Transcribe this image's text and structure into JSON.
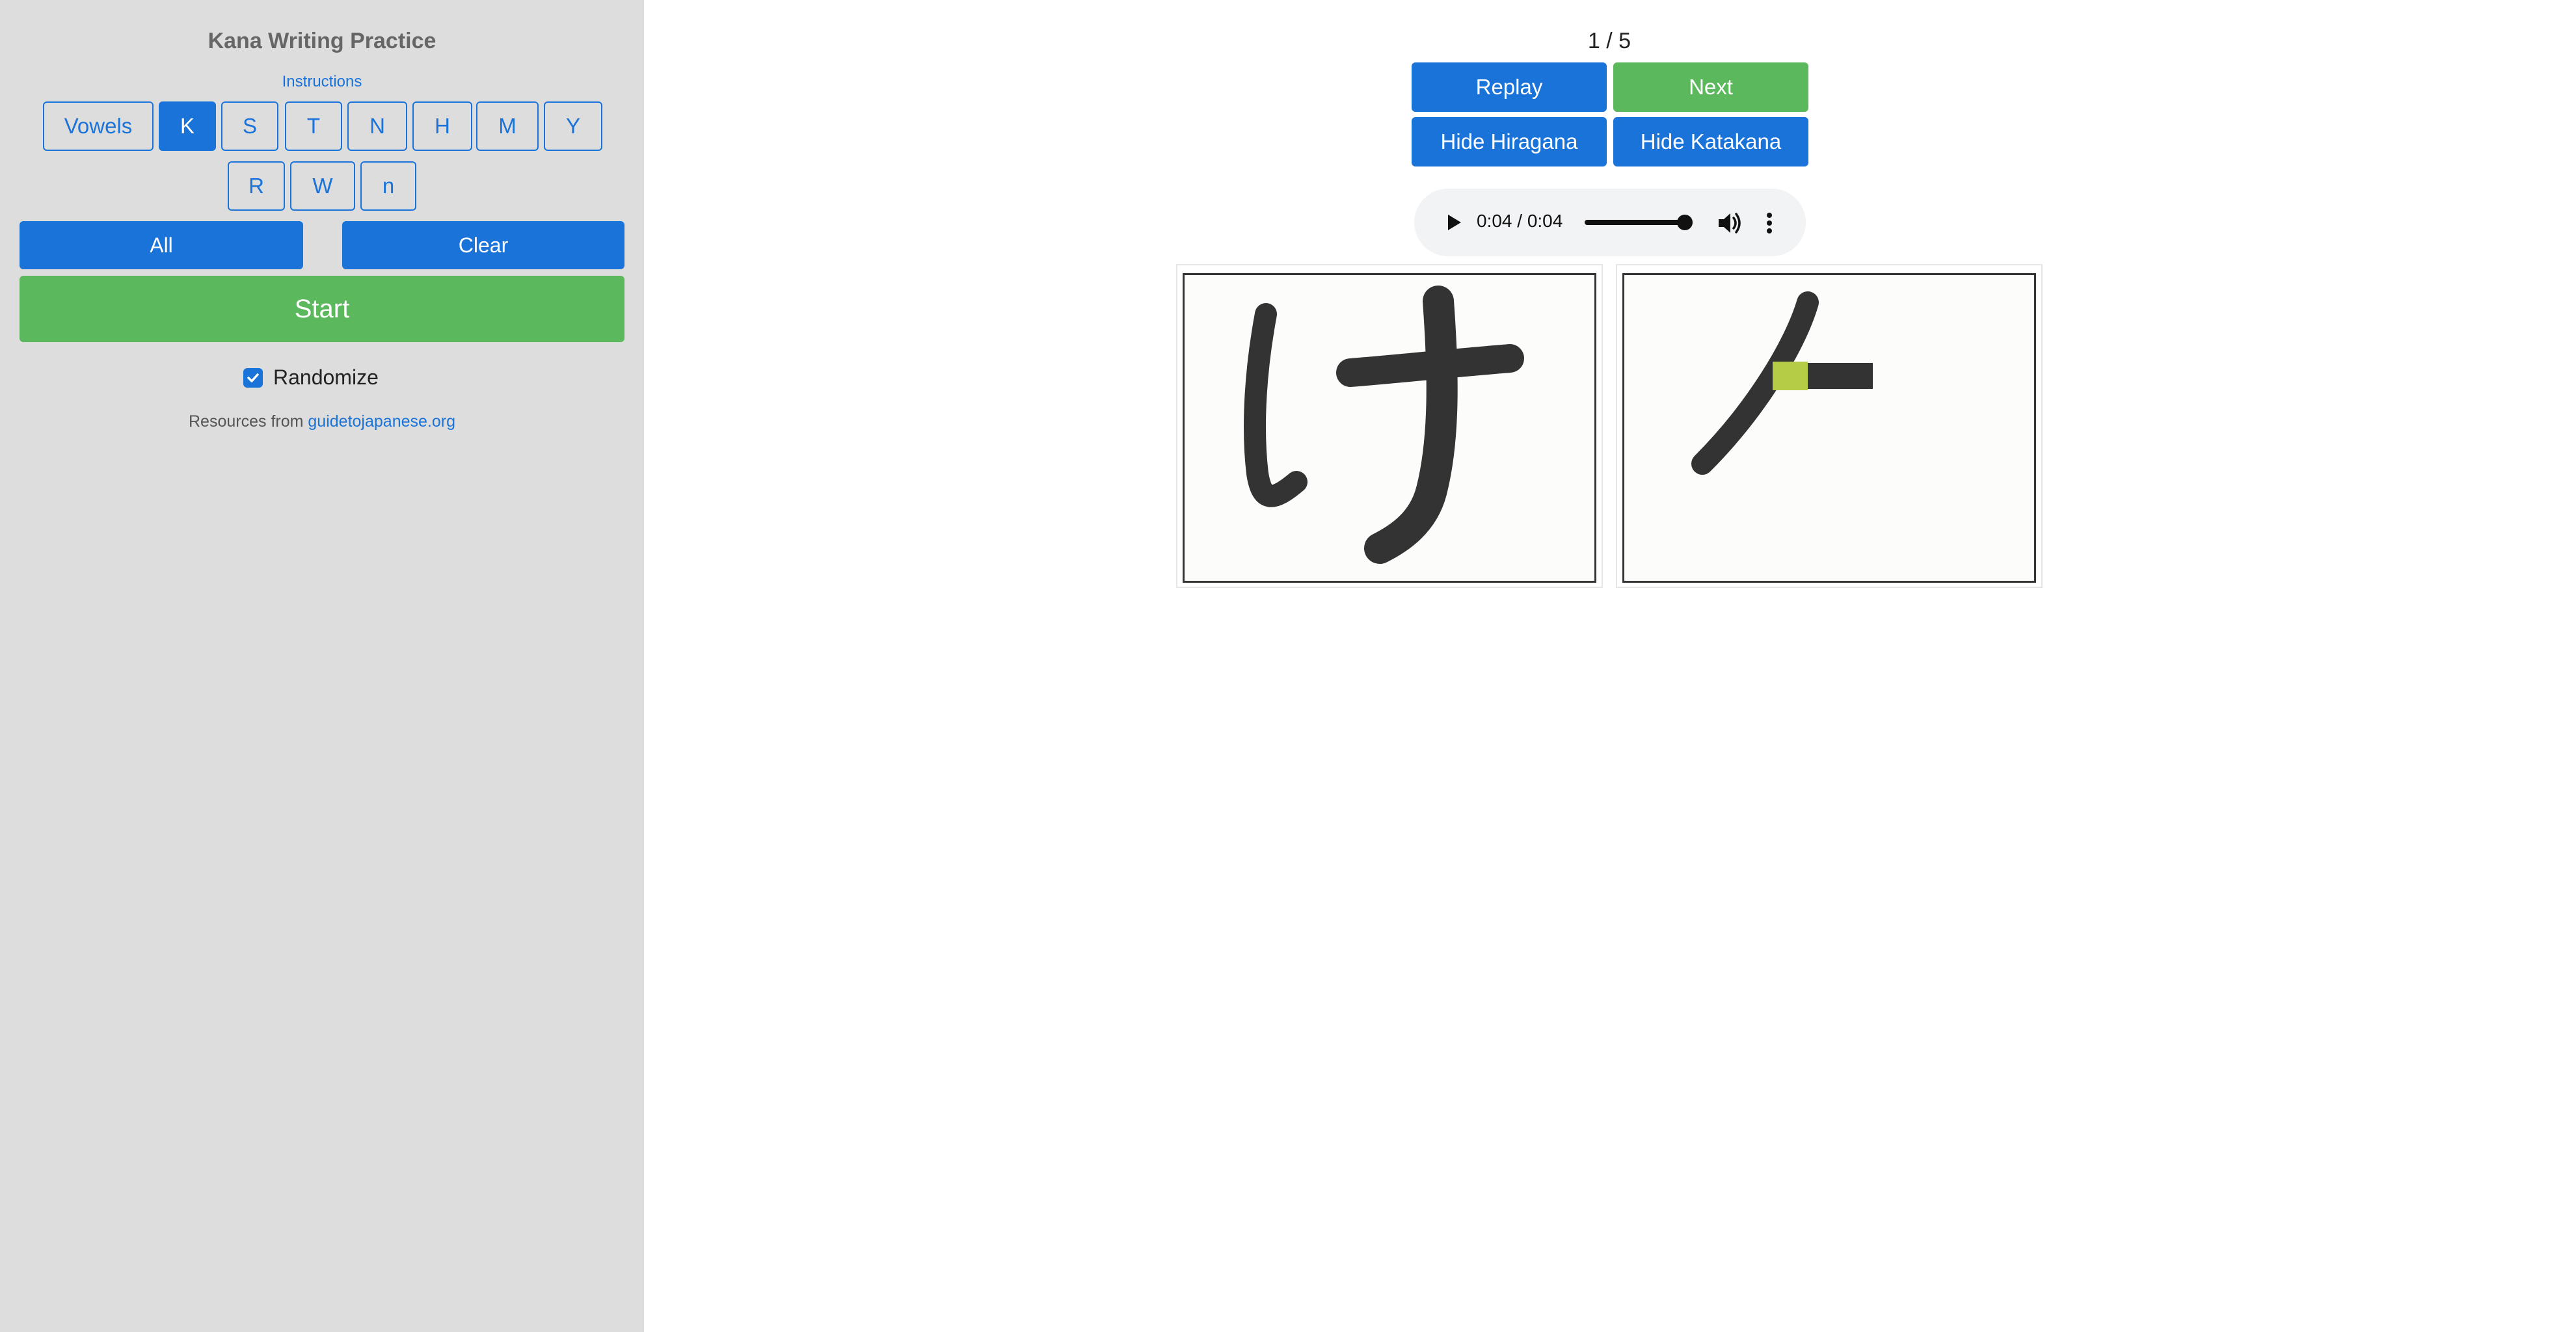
{
  "sidebar": {
    "title": "Kana Writing Practice",
    "instructions_link": "Instructions",
    "row_buttons": [
      "Vowels",
      "K",
      "S",
      "T",
      "N",
      "H",
      "M",
      "Y",
      "R",
      "W",
      "n"
    ],
    "selected_row": "K",
    "all_label": "All",
    "clear_label": "Clear",
    "start_label": "Start",
    "randomize_label": "Randomize",
    "randomize_checked": true,
    "resources_prefix": "Resources from",
    "resources_link": "guidetojapanese.org"
  },
  "main": {
    "counter": "1 / 5",
    "replay_label": "Replay",
    "next_label": "Next",
    "hide_hiragana_label": "Hide Hiragana",
    "hide_katakana_label": "Hide Katakana",
    "audio": {
      "time": "0:04 / 0:04",
      "progress": 1.0,
      "play_icon": "play-icon",
      "volume_icon": "volume-icon",
      "menu_icon": "more-vertical-icon"
    },
    "hiragana_card": {
      "character": "け"
    },
    "katakana_card": {
      "character": "ケ",
      "stroke_highlight_color": "#b5cc47"
    }
  },
  "colors": {
    "primary": "#1a73d9",
    "success": "#5cb85c",
    "sidebar_bg": "#dddddd",
    "ink": "#333333"
  }
}
